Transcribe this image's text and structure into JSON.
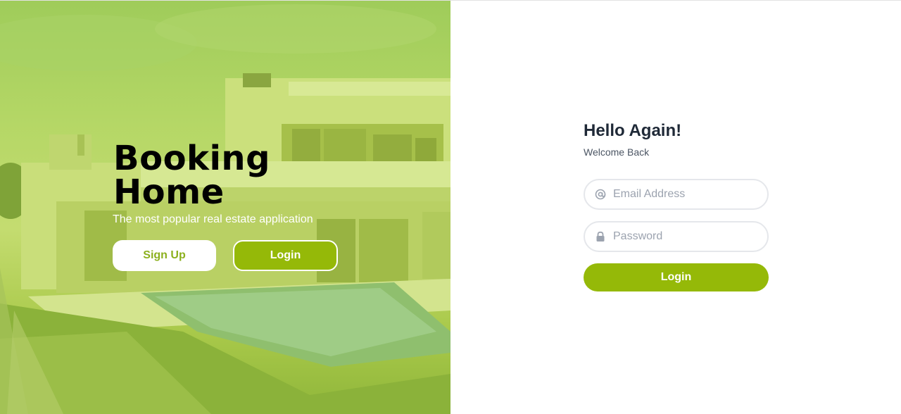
{
  "hero": {
    "title_line1": "Booking",
    "title_line2": "Home",
    "subtitle": "The most popular real estate application",
    "signup_label": "Sign Up",
    "login_label": "Login",
    "overlay_color": "#a8cc3c"
  },
  "login_form": {
    "title": "Hello Again!",
    "subtitle": "Welcome Back",
    "email": {
      "value": "",
      "placeholder": "Email Address",
      "icon": "at-icon"
    },
    "password": {
      "value": "",
      "placeholder": "Password",
      "icon": "lock-icon"
    },
    "submit_label": "Login",
    "accent_color": "#95b908"
  }
}
